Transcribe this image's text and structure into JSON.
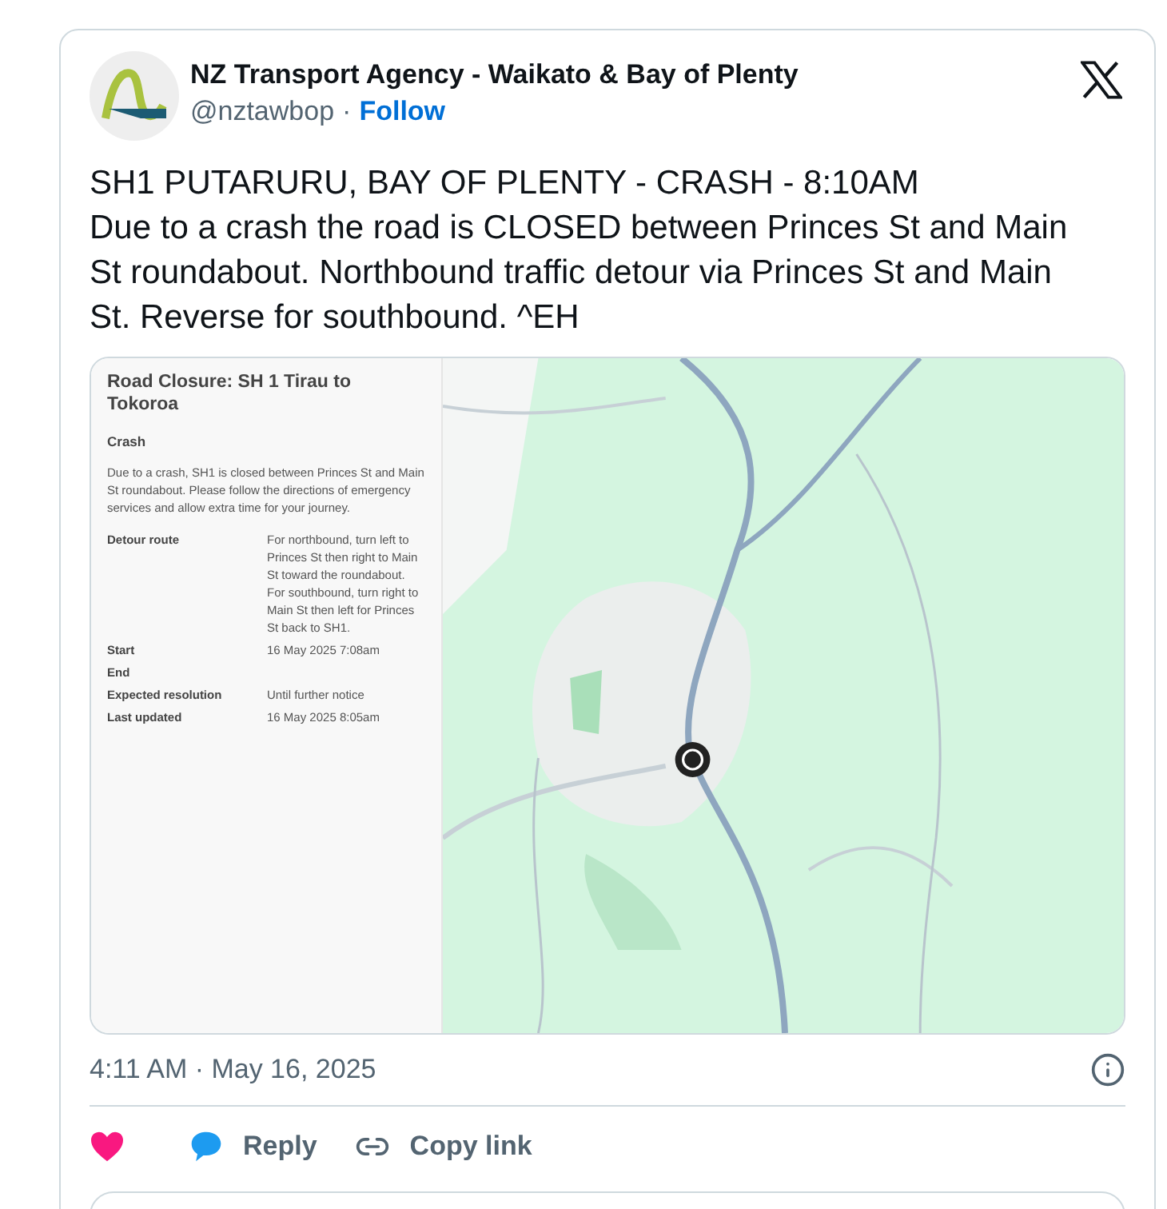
{
  "author": {
    "name": "NZ Transport Agency - Waikato & Bay of Plenty",
    "handle": "@nztawbop",
    "separator": "·",
    "follow": "Follow"
  },
  "tweet_text": [
    "SH1 PUTARURU, BAY OF PLENTY - CRASH - 8:10AM",
    "Due to a crash the road is CLOSED between Princes St and Main St roundabout. Northbound traffic detour via Princes St and Main St. Reverse for southbound. ^EH"
  ],
  "panel": {
    "title": "Road Closure: SH 1 Tirau to Tokoroa",
    "category": "Crash",
    "description": "Due to a crash, SH1 is closed between Princes St and Main St roundabout. Please follow the directions of emergency services and allow extra time for your journey.",
    "details": [
      {
        "label": "Detour route",
        "value": "For northbound, turn left to Princes St then right to Main St toward the roundabout. For southbound, turn right to Main St then left for Princes St back to SH1."
      },
      {
        "label": "Start",
        "value": "16 May 2025 7:08am"
      },
      {
        "label": "End"
      },
      {
        "label": "Expected resolution",
        "value": "Until further notice"
      },
      {
        "label": "Last updated",
        "value": "16 May 2025 8:05am"
      }
    ]
  },
  "map": {
    "kind": "picture"
  },
  "timestamp": "4:11 AM · May 16, 2025",
  "actions": [
    {
      "kind": "like"
    },
    {
      "kind": "reply",
      "label": "Reply"
    },
    {
      "kind": "copy",
      "label": "Copy link"
    }
  ]
}
